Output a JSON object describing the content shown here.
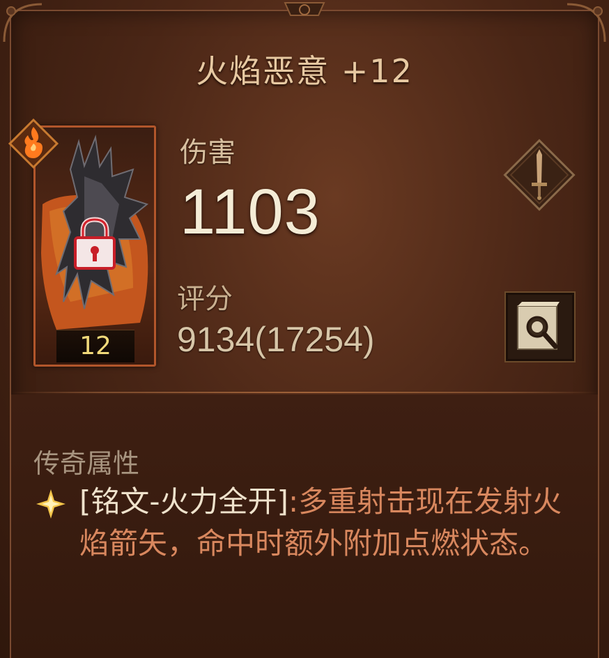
{
  "item": {
    "title": "火焰恶意 +12",
    "level": "12"
  },
  "stats": {
    "damage_label": "伤害",
    "damage_value": "1103",
    "score_label": "评分",
    "score_value": "9134(17254)"
  },
  "legendary": {
    "section_label": "传奇属性",
    "name": "[铭文-火力全开]",
    "description": ":多重射击现在发射火焰箭矢，命中时额外附加点燃状态。"
  },
  "icons": {
    "class_badge": "fire-class-icon",
    "lock": "lock-icon",
    "weapon_type": "sword-icon",
    "inspect": "inspect-icon",
    "legendary_marker": "star-icon"
  },
  "colors": {
    "title": "#e7c9a2",
    "damage": "#f4ecd6",
    "legendary_name": "#efe2cc",
    "legendary_text": "#d8875e",
    "level": "#f0d97a",
    "frame_accent": "#b2562b"
  }
}
